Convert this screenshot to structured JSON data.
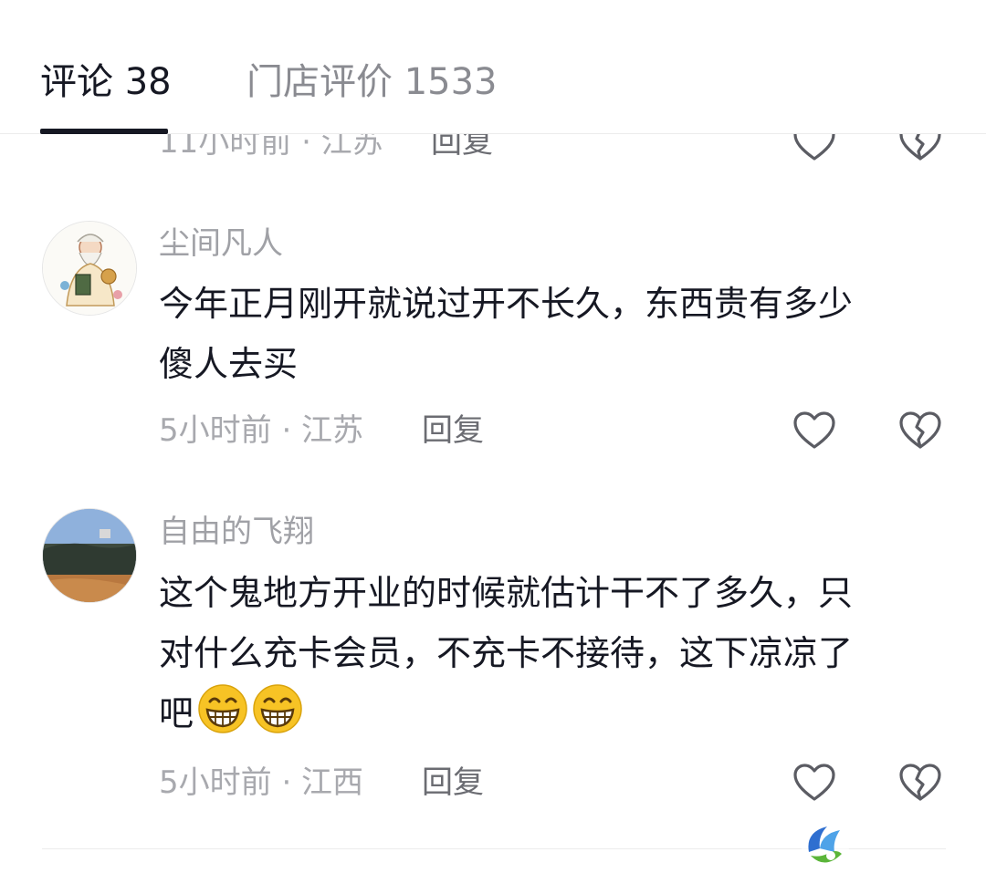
{
  "tabs": {
    "comments_label": "评论 38",
    "reviews_label": "门店评价 1533"
  },
  "partial_comment": {
    "meta": "11小时前 · 江苏",
    "reply_label": "回复"
  },
  "comments": [
    {
      "username": "尘间凡人",
      "text_line1": "今年正月刚开就说过开不长久，东西贵有多少",
      "text_line2": "傻人去买",
      "meta": "5小时前 · 江苏",
      "reply_label": "回复"
    },
    {
      "username": "自由的飞翔",
      "text_line1": "这个鬼地方开业的时候就估计干不了多久，只",
      "text_line2": "对什么充卡会员，不充卡不接待，这下凉凉了",
      "text_line3": "吧",
      "emojis": [
        "grin-emoji",
        "grin-emoji"
      ],
      "meta": "5小时前 · 江西",
      "reply_label": "回复"
    }
  ],
  "icons": {
    "like": "heart-icon",
    "dislike": "broken-heart-icon",
    "watermark": "logo-watermark"
  },
  "colors": {
    "text_primary": "#161823",
    "text_secondary": "#a8a9ae",
    "tab_active_indicator": "#161823",
    "emoji_yellow": "#f7c325"
  }
}
